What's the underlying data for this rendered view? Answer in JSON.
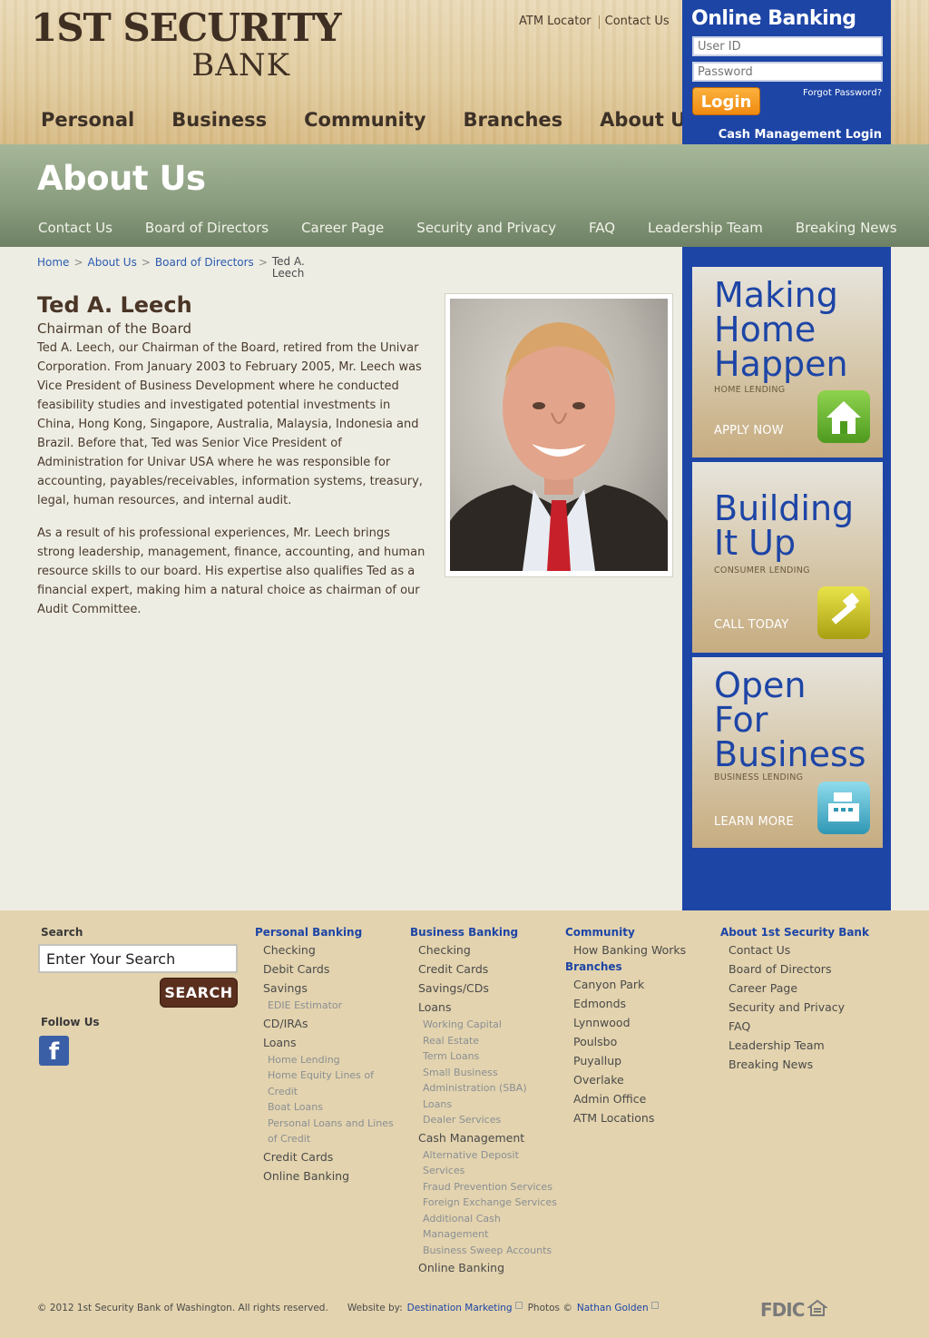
{
  "brand": {
    "logo_line1": "1ST SECURITY",
    "logo_line2": "BANK",
    "blue": "#1d45a6",
    "orange": "#f39a1f",
    "brown": "#5a2f1e"
  },
  "utility_links": [
    "ATM Locator",
    "Contact Us"
  ],
  "main_nav": [
    "Personal",
    "Business",
    "Community",
    "Branches",
    "About Us"
  ],
  "online_banking": {
    "title": "Online Banking",
    "user_placeholder": "User ID",
    "password_placeholder": "Password",
    "login_label": "Login",
    "forgot_label": "Forgot Password?",
    "cash_mgmt_label": "Cash Management Login"
  },
  "section": {
    "title": "About Us",
    "sub_nav": [
      "Contact Us",
      "Board of Directors",
      "Career Page",
      "Security and Privacy",
      "FAQ",
      "Leadership Team",
      "Breaking News"
    ]
  },
  "breadcrumb": {
    "items": [
      "Home",
      "About Us",
      "Board of Directors"
    ],
    "current": "Ted A. Leech"
  },
  "profile": {
    "name": "Ted A. Leech",
    "title": "Chairman of the Board",
    "paragraphs": [
      "Ted A. Leech, our Chairman of the Board, retired from the Univar Corporation. From January 2003 to February 2005, Mr. Leech was Vice President of Business Development where he conducted feasibility studies and investigated potential investments in China, Hong Kong, Singapore, Australia, Malaysia, Indonesia and Brazil. Before that, Ted was Senior Vice President of Administration for Univar USA where he was responsible for accounting, payables/receivables, information systems, treasury, legal, human resources, and internal audit.",
      "As a result of his professional experiences, Mr. Leech brings strong leadership, management, finance, accounting, and human resource skills to our board. His expertise also qualifies Ted as a financial expert, making him a natural choice as chairman of our Audit Committee."
    ]
  },
  "promos": [
    {
      "headline_lines": [
        "Making",
        "Home",
        "Happen"
      ],
      "subtitle": "HOME LENDING",
      "cta": "APPLY NOW",
      "icon": "house-icon",
      "icon_color": "#5fae2a"
    },
    {
      "headline_lines": [
        "Building",
        "It Up"
      ],
      "subtitle": "CONSUMER LENDING",
      "cta": "CALL TODAY",
      "icon": "hammer-icon",
      "icon_color": "#c9c21c"
    },
    {
      "headline_lines": [
        "Open",
        "For",
        "Business"
      ],
      "subtitle": "BUSINESS LENDING",
      "cta": "LEARN MORE",
      "icon": "register-icon",
      "icon_color": "#4fb8d0"
    }
  ],
  "footer": {
    "search_label": "Search",
    "search_value": "Enter Your Search",
    "search_button": "SEARCH",
    "follow_label": "Follow Us",
    "facebook_glyph": "f",
    "personal": {
      "head": "Personal Banking",
      "items": [
        [
          "Checking",
          1
        ],
        [
          "Debit Cards",
          1
        ],
        [
          "Savings",
          1
        ],
        [
          "EDIE Estimator",
          2
        ],
        [
          "CD/IRAs",
          1
        ],
        [
          "Loans",
          1
        ],
        [
          "Home Lending",
          2
        ],
        [
          "Home Equity Lines of Credit",
          2
        ],
        [
          "Boat Loans",
          2
        ],
        [
          "Personal Loans and Lines of Credit",
          2
        ],
        [
          "Credit Cards",
          1
        ],
        [
          "Online Banking",
          1
        ]
      ]
    },
    "business": {
      "head": "Business Banking",
      "items": [
        [
          "Checking",
          1
        ],
        [
          "Credit Cards",
          1
        ],
        [
          "Savings/CDs",
          1
        ],
        [
          "Loans",
          1
        ],
        [
          "Working Capital",
          2
        ],
        [
          "Real Estate",
          2
        ],
        [
          "Term Loans",
          2
        ],
        [
          "Small Business Administration (SBA) Loans",
          2
        ],
        [
          "Dealer Services",
          2
        ],
        [
          "Cash Management",
          1
        ],
        [
          "Alternative Deposit Services",
          2
        ],
        [
          "Fraud Prevention Services",
          2
        ],
        [
          "Foreign Exchange Services",
          2
        ],
        [
          "Additional Cash Management",
          2
        ],
        [
          "Business Sweep Accounts",
          2
        ],
        [
          "Online Banking",
          1
        ]
      ]
    },
    "community": {
      "head": "Community",
      "items": [
        [
          "How Banking Works",
          1
        ]
      ],
      "head2": "Branches",
      "items2": [
        [
          "Canyon Park",
          1
        ],
        [
          "Edmonds",
          1
        ],
        [
          "Lynnwood",
          1
        ],
        [
          "Poulsbo",
          1
        ],
        [
          "Puyallup",
          1
        ],
        [
          "Overlake",
          1
        ],
        [
          "Admin Office",
          1
        ],
        [
          "ATM Locations",
          1
        ]
      ]
    },
    "about": {
      "head": "About 1st Security Bank",
      "items": [
        [
          "Contact Us",
          1
        ],
        [
          "Board of Directors",
          1
        ],
        [
          "Career Page",
          1
        ],
        [
          "Security and Privacy",
          1
        ],
        [
          "FAQ",
          1
        ],
        [
          "Leadership Team",
          1
        ],
        [
          "Breaking News",
          1
        ]
      ]
    },
    "copyright": "© 2012 1st Security Bank of Washington. All rights reserved.",
    "website_by_label": "Website by:",
    "website_by_link": "Destination Marketing",
    "photos_label": "Photos ©",
    "photos_link": "Nathan Golden",
    "fdic": "FDIC"
  }
}
